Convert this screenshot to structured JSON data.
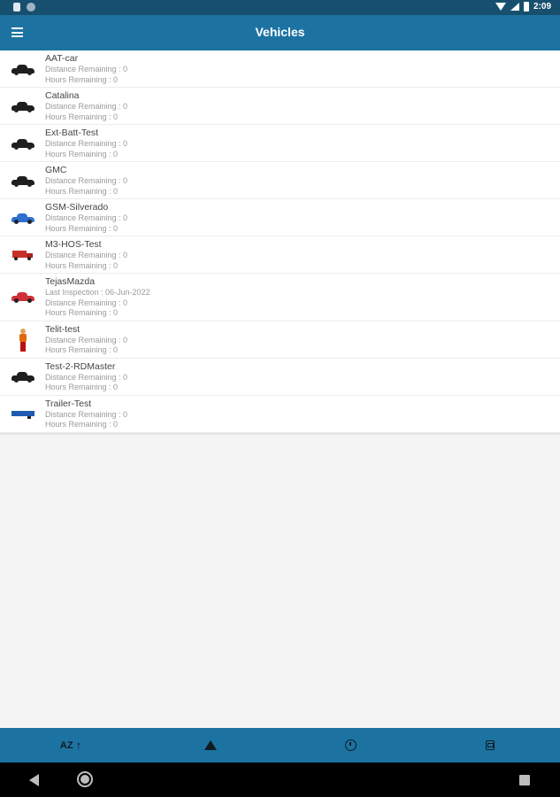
{
  "status_bar": {
    "time": "2:09"
  },
  "app_bar": {
    "title": "Vehicles"
  },
  "vehicles": [
    {
      "name": "AAT-car",
      "icon": "car-black-icon",
      "lines": [
        "Distance Remaining : 0",
        "Hours Remaining : 0"
      ]
    },
    {
      "name": "Catalina",
      "icon": "car-black-icon",
      "lines": [
        "Distance Remaining : 0",
        "Hours Remaining : 0"
      ]
    },
    {
      "name": "Ext-Batt-Test",
      "icon": "car-black-icon",
      "lines": [
        "Distance Remaining : 0",
        "Hours Remaining : 0"
      ]
    },
    {
      "name": "GMC",
      "icon": "car-black-icon",
      "lines": [
        "Distance Remaining : 0",
        "Hours Remaining : 0"
      ]
    },
    {
      "name": "GSM-Silverado",
      "icon": "car-blue-icon",
      "lines": [
        "Distance Remaining : 0",
        "Hours Remaining : 0"
      ]
    },
    {
      "name": "M3-HOS-Test",
      "icon": "truck-red-icon",
      "lines": [
        "Distance Remaining : 0",
        "Hours Remaining : 0"
      ]
    },
    {
      "name": "TejasMazda",
      "icon": "car-red-icon",
      "lines": [
        "Last Inspection : 06-Jun-2022",
        "Distance Remaining : 0",
        "Hours Remaining : 0"
      ]
    },
    {
      "name": "Telit-test",
      "icon": "person-icon",
      "lines": [
        "Distance Remaining : 0",
        "Hours Remaining : 0"
      ]
    },
    {
      "name": "Test-2-RDMaster",
      "icon": "car-black-icon",
      "lines": [
        "Distance Remaining : 0",
        "Hours Remaining : 0"
      ]
    },
    {
      "name": "Trailer-Test",
      "icon": "trailer-blue-icon",
      "lines": [
        "Distance Remaining : 0",
        "Hours Remaining : 0"
      ]
    }
  ],
  "bottom_bar": {
    "sort_label": "AZ",
    "sort_arrow": "↑"
  },
  "colors": {
    "status_bar": "#17506f",
    "app_bar": "#1c73a2",
    "black_car": "#1e1e1e",
    "blue_car": "#2f6fd0",
    "red_car": "#d0303a"
  }
}
